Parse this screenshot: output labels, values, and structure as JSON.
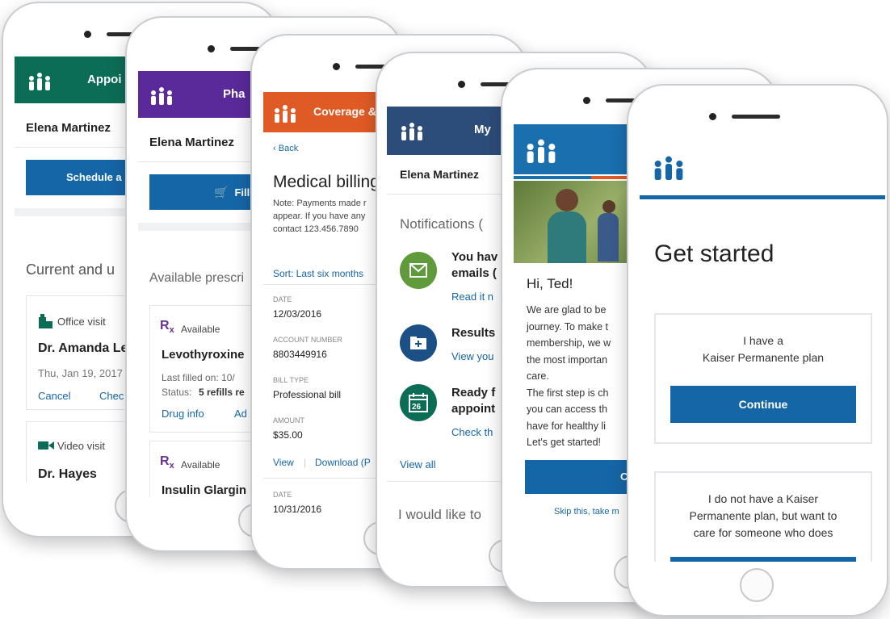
{
  "colors": {
    "kp_blue": "#1566a7",
    "green_header": "#0c6d57",
    "purple_header": "#5a2a9a",
    "orange_header": "#e05a25",
    "navy_header": "#2c4d7a",
    "light_blue_header": "#1a6fae",
    "rx_purple": "#6a2f98"
  },
  "phone1": {
    "header_title": "Appoi",
    "user_name": "Elena Martinez",
    "schedule_button": "Schedule a",
    "section_title": "Current and u",
    "visit1": {
      "type": "Office visit",
      "doctor": "Dr. Amanda Le",
      "date": "Thu, Jan 19, 2017",
      "cancel": "Cancel",
      "check": "Chec"
    },
    "visit2": {
      "type": "Video visit",
      "doctor": "Dr. Hayes"
    }
  },
  "phone2": {
    "header_title": "Pha",
    "user_name": "Elena Martinez",
    "fill_button": "Fill",
    "section_title": "Available prescri",
    "rx1": {
      "badge": "Available",
      "drug": "Levothyroxine",
      "last_filled_label": "Last filled on: 10/",
      "status_label": "Status:",
      "status_value": "5 refills re",
      "drug_info": "Drug info",
      "add": "Ad"
    },
    "rx2": {
      "badge": "Available",
      "drug": "Insulin Glargin"
    }
  },
  "phone3": {
    "header_title": "Coverage &",
    "back": "Back",
    "page_title": "Medical billing",
    "note_line1": "Note: Payments made r",
    "note_line2": "appear. If you have any",
    "note_line3": "contact 123.456.7890",
    "sort": "Sort: Last six months",
    "date_label": "DATE",
    "date_value": "12/03/2016",
    "account_label": "ACCOUNT NUMBER",
    "account_value": "8803449916",
    "bill_type_label": "BILL TYPE",
    "bill_type_value": "Professional bill",
    "amount_label": "AMOUNT",
    "amount_value": "$35.00",
    "view": "View",
    "download": "Download (P",
    "date2_label": "DATE",
    "date2_value": "10/31/2016"
  },
  "phone4": {
    "header_title": "My",
    "user_name": "Elena Martinez",
    "notifications_title": "Notifications (",
    "n1_title_line1": "You hav",
    "n1_title_line2": "emails (",
    "n1_link": "Read it n",
    "n2_title": "Results",
    "n2_link": "View you",
    "n3_title_line1": "Ready f",
    "n3_title_line2": "appoint",
    "n3_link": "Check th",
    "calendar_day": "26",
    "view_all": "View all",
    "would_like": "I would like to"
  },
  "phone5": {
    "greeting": "Hi, Ted!",
    "body": [
      "We are glad to be",
      "journey. To make t",
      "membership, we w",
      "the most importan",
      "care.",
      "The first step is ch",
      "you can access th",
      "have for healthy li",
      "Let's get started!"
    ],
    "continue_button": "Co",
    "skip": "Skip this, take m"
  },
  "phone6": {
    "title": "Get started",
    "option1_line1": "I have a",
    "option1_line2": "Kaiser Permanente plan",
    "continue_button": "Continue",
    "option2_line1": "I do not have a Kaiser",
    "option2_line2": "Permanente plan, but want to",
    "option2_line3": "care for someone who does"
  }
}
